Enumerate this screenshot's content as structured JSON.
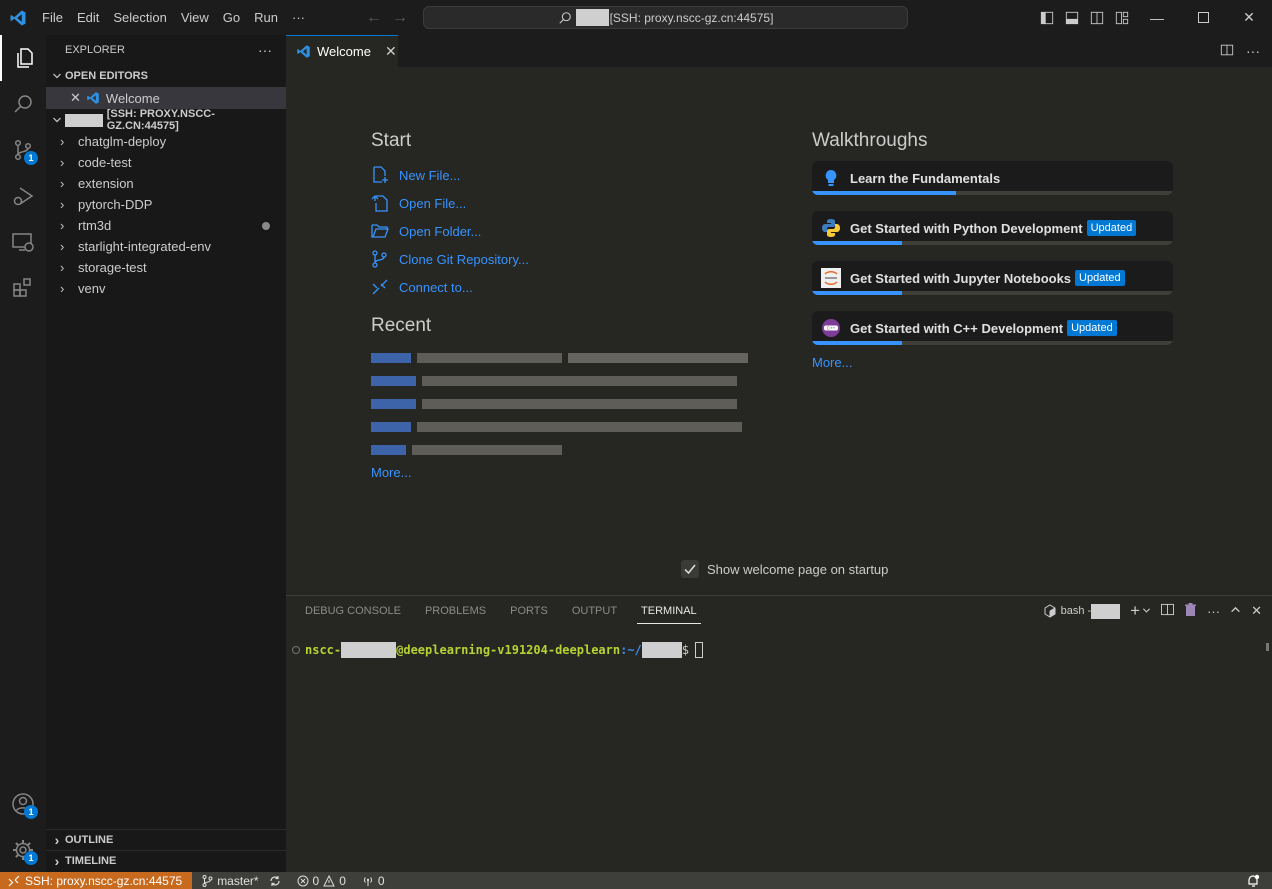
{
  "titlebar": {
    "menu": [
      "File",
      "Edit",
      "Selection",
      "View",
      "Go",
      "Run",
      "···"
    ],
    "command_center": "[SSH: proxy.nscc-gz.cn:44575]"
  },
  "activitybar": {
    "items": [
      "explorer",
      "search",
      "source-control",
      "run-and-debug",
      "remote-explorer",
      "extensions"
    ],
    "source_control_badge": "1",
    "accounts_badge": "1",
    "manage_badge": "1"
  },
  "sidebar": {
    "title": "EXPLORER",
    "more": "···",
    "open_editors_label": "OPEN EDITORS",
    "open_editors": [
      {
        "label": "Welcome"
      }
    ],
    "workspace_label": "[SSH: PROXY.NSCC-GZ.CN:44575]",
    "folders": [
      {
        "label": "chatglm-deploy",
        "modified": false
      },
      {
        "label": "code-test",
        "modified": false
      },
      {
        "label": "extension",
        "modified": false
      },
      {
        "label": "pytorch-DDP",
        "modified": false
      },
      {
        "label": "rtm3d",
        "modified": true
      },
      {
        "label": "starlight-integrated-env",
        "modified": false
      },
      {
        "label": "storage-test",
        "modified": false
      },
      {
        "label": "venv",
        "modified": false
      }
    ],
    "outline_label": "OUTLINE",
    "timeline_label": "TIMELINE"
  },
  "editor": {
    "tab_label": "Welcome",
    "start": {
      "heading": "Start",
      "links": [
        "New File...",
        "Open File...",
        "Open Folder...",
        "Clone Git Repository...",
        "Connect to..."
      ]
    },
    "recent": {
      "heading": "Recent",
      "more": "More..."
    },
    "walkthroughs": {
      "heading": "Walkthroughs",
      "items": [
        {
          "title": "Learn the Fundamentals",
          "badge": "",
          "progress": 0.4
        },
        {
          "title": "Get Started with Python Development",
          "badge": "Updated",
          "progress": 0.25
        },
        {
          "title": "Get Started with Jupyter Notebooks",
          "badge": "Updated",
          "progress": 0.25
        },
        {
          "title": "Get Started with C++ Development",
          "badge": "Updated",
          "progress": 0.25
        }
      ],
      "more": "More..."
    },
    "show_on_startup": "Show welcome page on startup",
    "show_on_startup_checked": true
  },
  "panel": {
    "tabs": [
      "DEBUG CONSOLE",
      "PROBLEMS",
      "PORTS",
      "OUTPUT",
      "TERMINAL"
    ],
    "active_tab": "TERMINAL",
    "terminal_name": "bash - ",
    "prompt_user_prefix": "nscc-",
    "prompt_host": "@deeplearning-v191204-deeplearn",
    "prompt_path_prefix": ":~/",
    "prompt_symbol": "$"
  },
  "statusbar": {
    "remote": "SSH: proxy.nscc-gz.cn:44575",
    "branch": "master*",
    "errors": "0",
    "warnings": "0",
    "ports": "0"
  },
  "colors": {
    "accent": "#0078d4",
    "link": "#3794ff",
    "remote": "#c76a1e"
  }
}
